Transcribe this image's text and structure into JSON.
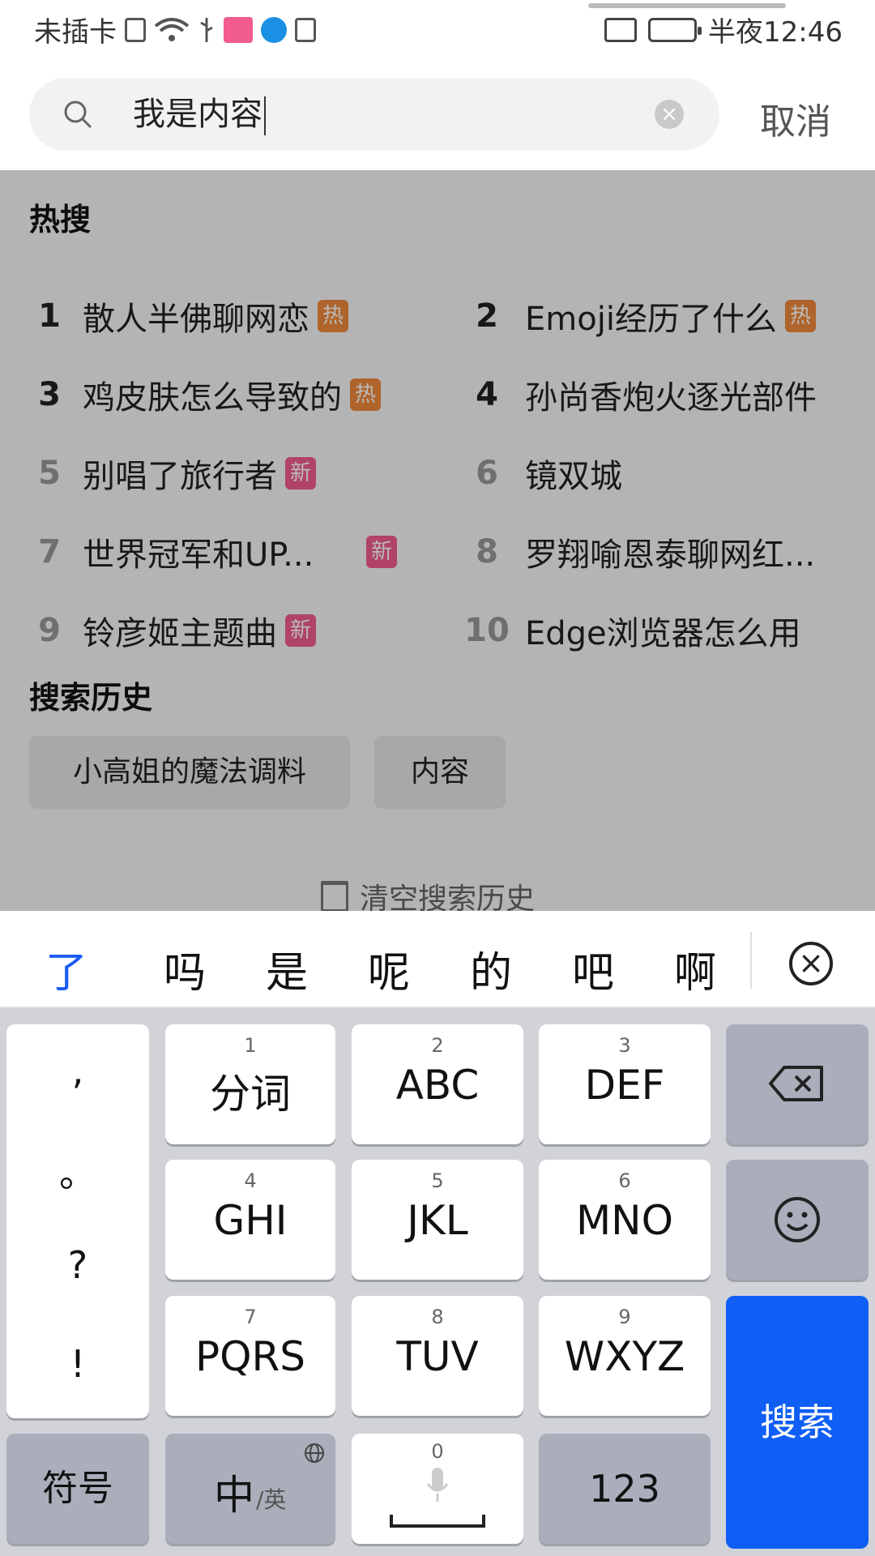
{
  "status_bar": {
    "carrier": "未插卡",
    "time": "半夜12:46"
  },
  "search": {
    "query": "我是内容",
    "cancel_label": "取消"
  },
  "hot": {
    "title": "热搜",
    "items": [
      {
        "rank": "1",
        "text": "散人半佛聊网恋",
        "badge": "热",
        "badge_type": "hot"
      },
      {
        "rank": "2",
        "text": "Emoji经历了什么",
        "badge": "热",
        "badge_type": "hot"
      },
      {
        "rank": "3",
        "text": "鸡皮肤怎么导致的",
        "badge": "热",
        "badge_type": "hot"
      },
      {
        "rank": "4",
        "text": "孙尚香炮火逐光部件",
        "badge": "",
        "badge_type": ""
      },
      {
        "rank": "5",
        "text": "别唱了旅行者",
        "badge": "新",
        "badge_type": "new"
      },
      {
        "rank": "6",
        "text": "镜双城",
        "badge": "",
        "badge_type": ""
      },
      {
        "rank": "7",
        "text": "世界冠军和UP...",
        "badge": "新",
        "badge_type": "new"
      },
      {
        "rank": "8",
        "text": "罗翔喻恩泰聊网红...",
        "badge": "",
        "badge_type": ""
      },
      {
        "rank": "9",
        "text": "铃彦姬主题曲",
        "badge": "新",
        "badge_type": "new"
      },
      {
        "rank": "10",
        "text": "Edge浏览器怎么用",
        "badge": "",
        "badge_type": ""
      }
    ]
  },
  "history": {
    "title": "搜索历史",
    "items": [
      "小高姐的魔法调料",
      "内容"
    ],
    "clear_label": "清空搜索历史"
  },
  "candidates": {
    "items": [
      "了",
      "吗",
      "是",
      "呢",
      "的",
      "吧",
      "啊"
    ]
  },
  "keyboard": {
    "punct": [
      ",",
      "。",
      "?",
      "!"
    ],
    "keys": [
      {
        "num": "1",
        "label": "分词"
      },
      {
        "num": "2",
        "label": "ABC"
      },
      {
        "num": "3",
        "label": "DEF"
      },
      {
        "num": "4",
        "label": "GHI"
      },
      {
        "num": "5",
        "label": "JKL"
      },
      {
        "num": "6",
        "label": "MNO"
      },
      {
        "num": "7",
        "label": "PQRS"
      },
      {
        "num": "8",
        "label": "TUV"
      },
      {
        "num": "9",
        "label": "WXYZ"
      }
    ],
    "symbol_label": "符号",
    "lang_main": "中",
    "lang_sub": "/英",
    "space_num": "0",
    "num_label": "123",
    "search_label": "搜索"
  },
  "colors": {
    "accent": "#0f5ff6",
    "hot_badge": "#f08a3c",
    "new_badge": "#f25d8e"
  },
  "icons": [
    "search-icon",
    "clear-icon",
    "trash-icon",
    "close-keyboard-icon",
    "backspace-icon",
    "emoji-icon",
    "globe-icon",
    "mic-icon"
  ]
}
